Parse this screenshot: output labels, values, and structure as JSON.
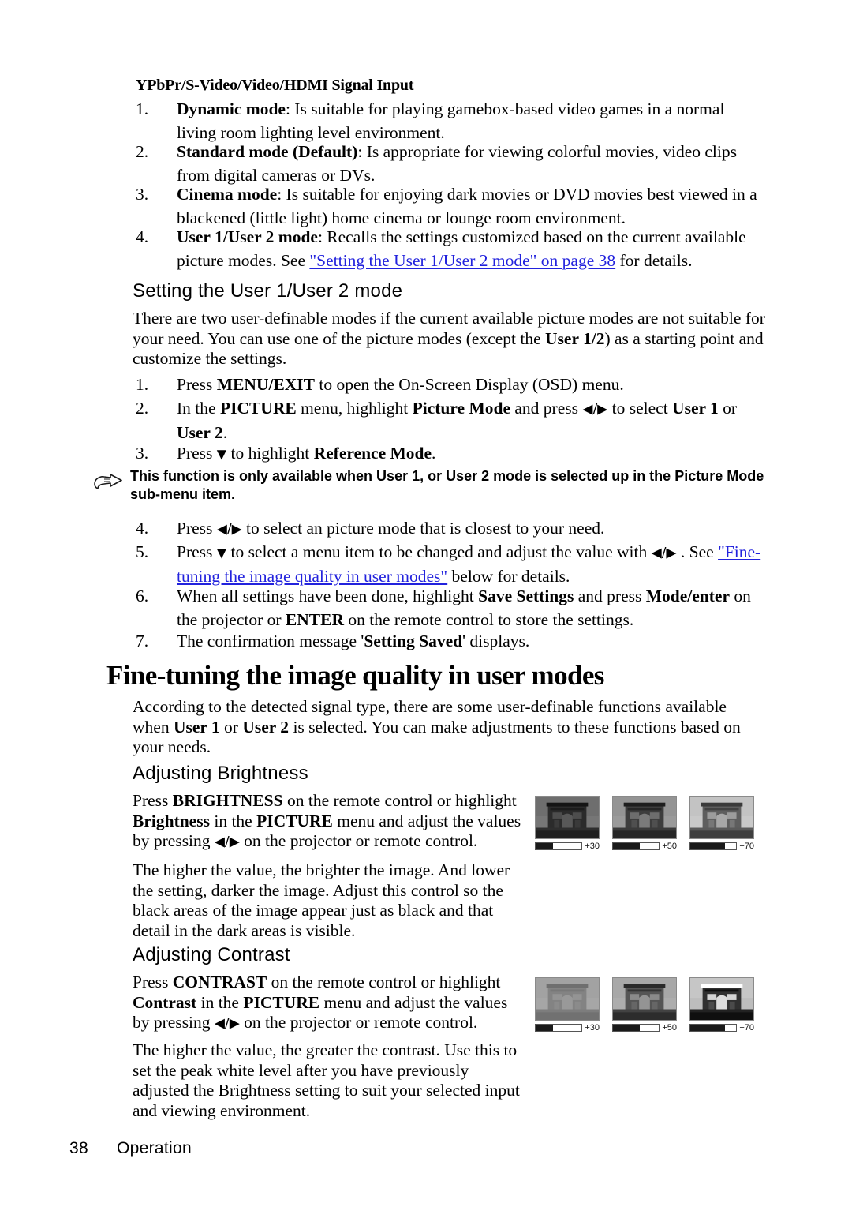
{
  "document": {
    "signal_heading": "YPbPr/S-Video/Video/HDMI Signal Input",
    "modes_list": [
      {
        "num": "1.",
        "bold": "Dynamic mode",
        "rest": ": Is suitable for playing gamebox-based video games in a normal living room lighting level environment."
      },
      {
        "num": "2.",
        "bold": "Standard mode (Default)",
        "rest": ": Is appropriate for viewing colorful movies, video clips from digital cameras or DVs."
      },
      {
        "num": "3.",
        "bold": "Cinema mode",
        "rest": ": Is suitable for enjoying dark movies or DVD movies best viewed in a blackened (little light) home cinema or lounge room environment."
      },
      {
        "num": "4.",
        "bold": "User 1/User 2 mode",
        "rest": ": Recalls the settings customized based on the current available picture modes. See ",
        "link": "\"Setting the User 1/User 2 mode\" on page 38",
        "tail": " for details."
      }
    ],
    "setting_user_section": {
      "heading": "Setting the User 1/User 2 mode",
      "intro_a": "There are two user-definable modes if the current available picture modes are not suitable for your need. You can use one of the picture modes (except the ",
      "intro_bold": "User 1/2",
      "intro_b": ") as a starting point and customize the settings.",
      "steps": [
        {
          "num": "1.",
          "pre": "Press ",
          "b1": "MENU/EXIT",
          "mid": " to open the On-Screen Display (OSD) menu."
        },
        {
          "num": "2.",
          "pre": "In the ",
          "b1": "PICTURE",
          "mid": " menu, highlight ",
          "b2": "Picture Mode",
          "mid2": " and press ",
          "arrows": "◀/▶",
          "mid3": " to select ",
          "b3": "User 1",
          "mid4": " or ",
          "b4": "User 2",
          "tail": "."
        },
        {
          "num": "3.",
          "pre": "Press ",
          "arrow_down": "▼",
          "mid": " to highlight ",
          "b1": "Reference Mode",
          "tail": "."
        }
      ],
      "note": "This function is only available when User 1, or User 2 mode is selected up in the Picture Mode sub-menu item.",
      "note_icon": "pointing-hand-icon",
      "steps_cont": [
        {
          "num": "4.",
          "pre": "Press ",
          "arrows": "◀/▶",
          "mid": " to select an picture mode that is closest to your need."
        },
        {
          "num": "5.",
          "pre": "Press ",
          "arrow_down": "▼",
          "mid": " to select a menu item to be changed and adjust the value with ",
          "arrows": "◀/▶",
          "mid2": " . See ",
          "link": "\"Fine-tuning the image quality in user modes\"",
          "tail": " below for details."
        },
        {
          "num": "6.",
          "pre": "When all settings have been done, highlight ",
          "b1": "Save Settings",
          "mid": " and press ",
          "b2": "Mode/enter",
          "mid2": " on the projector or ",
          "b3": "ENTER",
          "tail": " on the remote control to store the settings."
        },
        {
          "num": "7.",
          "pre": "The confirmation message '",
          "b1": "Setting Saved",
          "tail": "' displays."
        }
      ]
    },
    "fine_tuning_section": {
      "heading": "Fine-tuning the image quality in user modes",
      "intro_a": "According to the detected signal type, there are some user-definable functions available when ",
      "intro_b1": "User 1",
      "intro_b": " or ",
      "intro_b2": "User 2",
      "intro_c": " is selected. You can make adjustments to these functions based on your needs."
    },
    "brightness_section": {
      "heading": "Adjusting Brightness",
      "para_a": "Press ",
      "para_b1": "BRIGHTNESS",
      "para_b": " on the remote control or highlight ",
      "para_b2": "Brightness",
      "para_c": " in the ",
      "para_b3": "PICTURE",
      "para_d": " menu and adjust the values by pressing ",
      "arrows": "◀/▶",
      "para_e": " on the projector or remote control.",
      "para2": "The higher the value, the brighter the image. And lower the setting, darker the image. Adjust this control so the black areas of the image appear just as black and that detail in the dark areas is visible."
    },
    "contrast_section": {
      "heading": "Adjusting Contrast",
      "para_a": "Press ",
      "para_b1": "CONTRAST",
      "para_b": " on the remote control or highlight ",
      "para_b2": "Contrast",
      "para_c": " in the ",
      "para_b3": "PICTURE",
      "para_d": " menu and adjust the values by pressing ",
      "arrows": "◀/▶",
      "para_e": " on the projector or remote control.",
      "para2": "The higher the value, the greater the contrast. Use this to set the peak white level after you have previously adjusted the Brightness setting to suit your selected input and viewing environment."
    },
    "illustrations": {
      "brightness": [
        {
          "label": "+30",
          "value": 30,
          "fill_pct": 38,
          "image": "arc-de-triomphe-photo",
          "brightness": 0.62
        },
        {
          "label": "+50",
          "value": 50,
          "fill_pct": 58,
          "image": "arc-de-triomphe-photo",
          "brightness": 0.82
        },
        {
          "label": "+70",
          "value": 70,
          "fill_pct": 76,
          "image": "arc-de-triomphe-photo",
          "brightness": 1.08
        }
      ],
      "contrast": [
        {
          "label": "+30",
          "value": 30,
          "fill_pct": 38,
          "image": "arc-de-triomphe-photo",
          "contrast": 0.55
        },
        {
          "label": "+50",
          "value": 50,
          "fill_pct": 58,
          "image": "arc-de-triomphe-photo",
          "contrast": 0.95
        },
        {
          "label": "+70",
          "value": 70,
          "fill_pct": 76,
          "image": "arc-de-triomphe-photo",
          "contrast": 1.5
        }
      ]
    },
    "footer": {
      "page_number": "38",
      "section": "Operation"
    }
  }
}
